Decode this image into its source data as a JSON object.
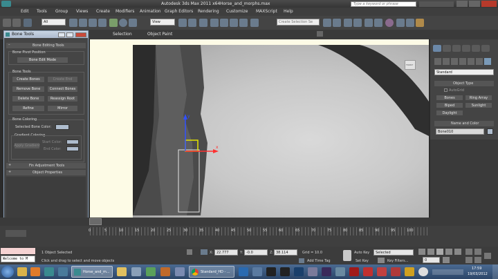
{
  "app": {
    "title": "Autodesk 3ds Max 2011 x64",
    "file": "Horse_and_morphs.max",
    "search_placeholder": "Type a keyword or phrase"
  },
  "menu": [
    "Edit",
    "Tools",
    "Group",
    "Views",
    "Create",
    "Modifiers",
    "Animation",
    "Graph Editors",
    "Rendering",
    "Customize",
    "MAXScript",
    "Help"
  ],
  "toolbar": {
    "selection_filter": "All",
    "ref_coord": "View",
    "named_selection": "Create Selection Se"
  },
  "ribbon": {
    "selection": "Selection",
    "object_paint": "Object Paint"
  },
  "bone_tools": {
    "title": "Bone Tools",
    "editing_header": "Bone Editing Tools",
    "pivot_label": "Bone Pivot Position",
    "edit_mode": "Bone Edit Mode",
    "tools_label": "Bone Tools",
    "create_bones": "Create Bones",
    "create_end": "Create End",
    "remove_bone": "Remove Bone",
    "connect_bones": "Connect Bones",
    "delete_bone": "Delete Bone",
    "reassign_root": "Reassign Root",
    "refine": "Refine",
    "mirror": "Mirror",
    "coloring_label": "Bone Coloring",
    "selected_color": "Selected Bone Color:",
    "gradient_label": "Gradient Coloring",
    "apply_gradient": "Apply Gradient",
    "start_color": "Start Color:",
    "end_color": "End Color:",
    "fin_tools": "Fin Adjustment Tools",
    "object_props": "Object Properties",
    "plus": "+"
  },
  "command_panel": {
    "category": "Standard",
    "object_type": "Object Type",
    "autogrid": "AutoGrid",
    "bones": "Bones",
    "ring_array": "Ring Array",
    "biped": "Biped",
    "sunlight": "Sunlight",
    "daylight": "Daylight",
    "name_color": "Name and Color",
    "name_value": "Bone010"
  },
  "viewport": {
    "viewcube_label": "FRONT"
  },
  "timeline": {
    "ticks": [
      "0",
      "5",
      "10",
      "15",
      "20",
      "25",
      "30",
      "35",
      "40",
      "45",
      "50",
      "55",
      "60",
      "65",
      "70",
      "75",
      "80",
      "85",
      "90",
      "95",
      "100"
    ]
  },
  "status": {
    "selected": "1 Object Selected",
    "prompt": "Click and drag to select and move objects",
    "x_label": "X:",
    "x_value": "22.777",
    "y_label": "Y:",
    "y_value": "-0.0",
    "z_label": "Z:",
    "z_value": "38.114",
    "grid": "Grid = 10.0",
    "add_time_tag": "Add Time Tag",
    "auto_key": "Auto Key",
    "auto_key_value": "Selected",
    "set_key": "Set Key",
    "key_filters": "Key Filters...",
    "frame": "0"
  },
  "maxscript": "Welcome to M",
  "taskbar": {
    "items": [
      "Horse_and_m...",
      "Standard_HD - ..."
    ],
    "time": "17:59",
    "date": "19/03/2012"
  }
}
